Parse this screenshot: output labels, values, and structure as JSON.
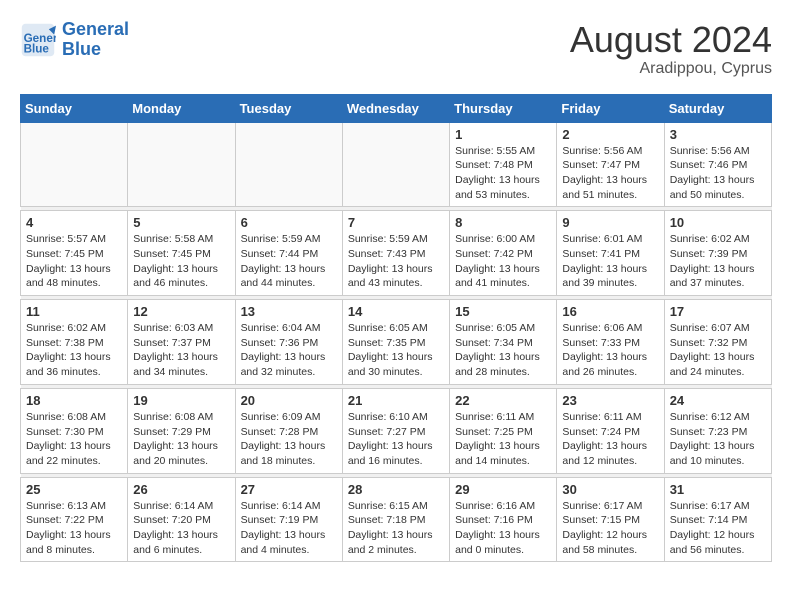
{
  "logo": {
    "line1": "General",
    "line2": "Blue"
  },
  "title": {
    "month_year": "August 2024",
    "location": "Aradippou, Cyprus"
  },
  "days_of_week": [
    "Sunday",
    "Monday",
    "Tuesday",
    "Wednesday",
    "Thursday",
    "Friday",
    "Saturday"
  ],
  "weeks": [
    [
      {
        "day": "",
        "info": ""
      },
      {
        "day": "",
        "info": ""
      },
      {
        "day": "",
        "info": ""
      },
      {
        "day": "",
        "info": ""
      },
      {
        "day": "1",
        "info": "Sunrise: 5:55 AM\nSunset: 7:48 PM\nDaylight: 13 hours\nand 53 minutes."
      },
      {
        "day": "2",
        "info": "Sunrise: 5:56 AM\nSunset: 7:47 PM\nDaylight: 13 hours\nand 51 minutes."
      },
      {
        "day": "3",
        "info": "Sunrise: 5:56 AM\nSunset: 7:46 PM\nDaylight: 13 hours\nand 50 minutes."
      }
    ],
    [
      {
        "day": "4",
        "info": "Sunrise: 5:57 AM\nSunset: 7:45 PM\nDaylight: 13 hours\nand 48 minutes."
      },
      {
        "day": "5",
        "info": "Sunrise: 5:58 AM\nSunset: 7:45 PM\nDaylight: 13 hours\nand 46 minutes."
      },
      {
        "day": "6",
        "info": "Sunrise: 5:59 AM\nSunset: 7:44 PM\nDaylight: 13 hours\nand 44 minutes."
      },
      {
        "day": "7",
        "info": "Sunrise: 5:59 AM\nSunset: 7:43 PM\nDaylight: 13 hours\nand 43 minutes."
      },
      {
        "day": "8",
        "info": "Sunrise: 6:00 AM\nSunset: 7:42 PM\nDaylight: 13 hours\nand 41 minutes."
      },
      {
        "day": "9",
        "info": "Sunrise: 6:01 AM\nSunset: 7:41 PM\nDaylight: 13 hours\nand 39 minutes."
      },
      {
        "day": "10",
        "info": "Sunrise: 6:02 AM\nSunset: 7:39 PM\nDaylight: 13 hours\nand 37 minutes."
      }
    ],
    [
      {
        "day": "11",
        "info": "Sunrise: 6:02 AM\nSunset: 7:38 PM\nDaylight: 13 hours\nand 36 minutes."
      },
      {
        "day": "12",
        "info": "Sunrise: 6:03 AM\nSunset: 7:37 PM\nDaylight: 13 hours\nand 34 minutes."
      },
      {
        "day": "13",
        "info": "Sunrise: 6:04 AM\nSunset: 7:36 PM\nDaylight: 13 hours\nand 32 minutes."
      },
      {
        "day": "14",
        "info": "Sunrise: 6:05 AM\nSunset: 7:35 PM\nDaylight: 13 hours\nand 30 minutes."
      },
      {
        "day": "15",
        "info": "Sunrise: 6:05 AM\nSunset: 7:34 PM\nDaylight: 13 hours\nand 28 minutes."
      },
      {
        "day": "16",
        "info": "Sunrise: 6:06 AM\nSunset: 7:33 PM\nDaylight: 13 hours\nand 26 minutes."
      },
      {
        "day": "17",
        "info": "Sunrise: 6:07 AM\nSunset: 7:32 PM\nDaylight: 13 hours\nand 24 minutes."
      }
    ],
    [
      {
        "day": "18",
        "info": "Sunrise: 6:08 AM\nSunset: 7:30 PM\nDaylight: 13 hours\nand 22 minutes."
      },
      {
        "day": "19",
        "info": "Sunrise: 6:08 AM\nSunset: 7:29 PM\nDaylight: 13 hours\nand 20 minutes."
      },
      {
        "day": "20",
        "info": "Sunrise: 6:09 AM\nSunset: 7:28 PM\nDaylight: 13 hours\nand 18 minutes."
      },
      {
        "day": "21",
        "info": "Sunrise: 6:10 AM\nSunset: 7:27 PM\nDaylight: 13 hours\nand 16 minutes."
      },
      {
        "day": "22",
        "info": "Sunrise: 6:11 AM\nSunset: 7:25 PM\nDaylight: 13 hours\nand 14 minutes."
      },
      {
        "day": "23",
        "info": "Sunrise: 6:11 AM\nSunset: 7:24 PM\nDaylight: 13 hours\nand 12 minutes."
      },
      {
        "day": "24",
        "info": "Sunrise: 6:12 AM\nSunset: 7:23 PM\nDaylight: 13 hours\nand 10 minutes."
      }
    ],
    [
      {
        "day": "25",
        "info": "Sunrise: 6:13 AM\nSunset: 7:22 PM\nDaylight: 13 hours\nand 8 minutes."
      },
      {
        "day": "26",
        "info": "Sunrise: 6:14 AM\nSunset: 7:20 PM\nDaylight: 13 hours\nand 6 minutes."
      },
      {
        "day": "27",
        "info": "Sunrise: 6:14 AM\nSunset: 7:19 PM\nDaylight: 13 hours\nand 4 minutes."
      },
      {
        "day": "28",
        "info": "Sunrise: 6:15 AM\nSunset: 7:18 PM\nDaylight: 13 hours\nand 2 minutes."
      },
      {
        "day": "29",
        "info": "Sunrise: 6:16 AM\nSunset: 7:16 PM\nDaylight: 13 hours\nand 0 minutes."
      },
      {
        "day": "30",
        "info": "Sunrise: 6:17 AM\nSunset: 7:15 PM\nDaylight: 12 hours\nand 58 minutes."
      },
      {
        "day": "31",
        "info": "Sunrise: 6:17 AM\nSunset: 7:14 PM\nDaylight: 12 hours\nand 56 minutes."
      }
    ]
  ]
}
